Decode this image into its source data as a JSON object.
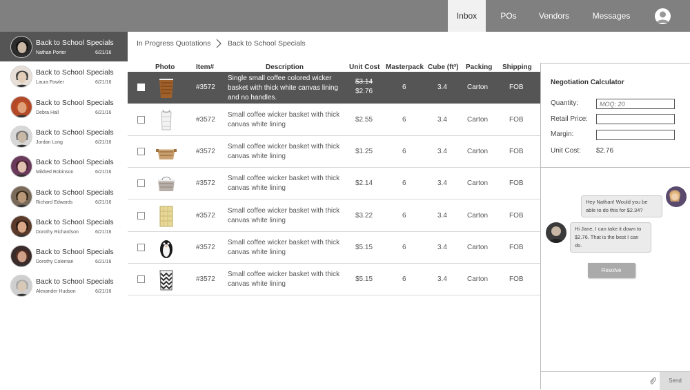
{
  "nav": {
    "tabs": [
      {
        "label": "Inbox"
      },
      {
        "label": "POs"
      },
      {
        "label": "Vendors"
      },
      {
        "label": "Messages"
      }
    ]
  },
  "sidebar": {
    "items": [
      {
        "title": "Back to School Specials",
        "name": "Nathan Porter",
        "date": "6/21/16"
      },
      {
        "title": "Back to School Specials",
        "name": "Laura Fowler",
        "date": "6/21/16"
      },
      {
        "title": "Back to School Specials",
        "name": "Debra Hall",
        "date": "6/21/16"
      },
      {
        "title": "Back to School Specials",
        "name": "Jordan Long",
        "date": "6/21/16"
      },
      {
        "title": "Back to School Specials",
        "name": "Mildred Robinson",
        "date": "6/21/16"
      },
      {
        "title": "Back to School Specials",
        "name": "Richard Edwards",
        "date": "6/21/16"
      },
      {
        "title": "Back to School Specials",
        "name": "Dorothy Richardson",
        "date": "6/21/16"
      },
      {
        "title": "Back to School Specials",
        "name": "Dorothy Coleman",
        "date": "6/21/16"
      },
      {
        "title": "Back to School Specials",
        "name": "Alexander Hudson",
        "date": "6/21/16"
      }
    ]
  },
  "breadcrumb": {
    "first": "In Progress Quotations",
    "second": "Back to School Specials"
  },
  "table": {
    "headers": {
      "photo": "Photo",
      "item": "Item#",
      "description": "Description",
      "unit_cost": "Unit Cost",
      "masterpack": "Masterpack",
      "cube": "Cube (ft³)",
      "packing": "Packing",
      "shipping": "Shipping"
    },
    "rows": [
      {
        "item": "#3572",
        "description": "Single small coffee colored wicker basket with thick white canvas lining and no handles.",
        "old_cost": "$3.14",
        "unit_cost": "$2.76",
        "masterpack": "6",
        "cube": "3.4",
        "packing": "Carton",
        "shipping": "FOB"
      },
      {
        "item": "#3572",
        "description": "Small coffee wicker basket with thick canvas white lining",
        "old_cost": "",
        "unit_cost": "$2.55",
        "masterpack": "6",
        "cube": "3.4",
        "packing": "Carton",
        "shipping": "FOB"
      },
      {
        "item": "#3572",
        "description": "Small coffee wicker basket with thick canvas white lining",
        "old_cost": "",
        "unit_cost": "$1.25",
        "masterpack": "6",
        "cube": "3.4",
        "packing": "Carton",
        "shipping": "FOB"
      },
      {
        "item": "#3572",
        "description": "Small coffee wicker basket with thick canvas white lining",
        "old_cost": "",
        "unit_cost": "$2.14",
        "masterpack": "6",
        "cube": "3.4",
        "packing": "Carton",
        "shipping": "FOB"
      },
      {
        "item": "#3572",
        "description": "Small coffee wicker basket with thick canvas white lining",
        "old_cost": "",
        "unit_cost": "$3.22",
        "masterpack": "6",
        "cube": "3.4",
        "packing": "Carton",
        "shipping": "FOB"
      },
      {
        "item": "#3572",
        "description": "Small coffee wicker basket with thick canvas white lining",
        "old_cost": "",
        "unit_cost": "$5.15",
        "masterpack": "6",
        "cube": "3.4",
        "packing": "Carton",
        "shipping": "FOB"
      },
      {
        "item": "#3572",
        "description": "Small coffee wicker basket with thick canvas white lining",
        "old_cost": "",
        "unit_cost": "$5.15",
        "masterpack": "6",
        "cube": "3.4",
        "packing": "Carton",
        "shipping": "FOB"
      }
    ]
  },
  "calculator": {
    "title": "Negotiation Calculator",
    "quantity_label": "Quantity:",
    "quantity_placeholder": "MOQ: 20",
    "retail_label": "Retail Price:",
    "margin_label": "Margin:",
    "unit_cost_label": "Unit Cost:",
    "unit_cost_value": "$2.76"
  },
  "chat": {
    "messages": [
      {
        "text": "Hey Nathan! Would you be able to do this for $2.34?"
      },
      {
        "text": "Hi Jane, I can take it down to $2.76. That is the best I can do."
      }
    ],
    "resolve_label": "Resolve",
    "send_label": "Send"
  },
  "colors": {
    "topbar": "#808080",
    "selected": "#555555",
    "accent_button": "#aaaaaa"
  }
}
